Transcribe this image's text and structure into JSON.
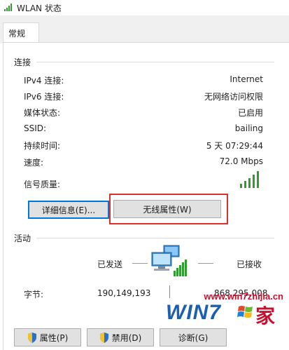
{
  "window": {
    "title": "WLAN 状态"
  },
  "tabs": [
    {
      "label": "常规"
    }
  ],
  "connection": {
    "section_label": "连接",
    "rows": [
      {
        "label": "IPv4 连接:",
        "value": "Internet"
      },
      {
        "label": "IPv6 连接:",
        "value": "无网络访问权限"
      },
      {
        "label": "媒体状态:",
        "value": "已启用"
      },
      {
        "label": "SSID:",
        "value": "bailing"
      },
      {
        "label": "持续时间:",
        "value": "5 天 07:29:44"
      },
      {
        "label": "速度:",
        "value": "72.0 Mbps"
      }
    ],
    "signal_label": "信号质量:",
    "signal_bars": 5,
    "details_button": "详细信息(E)...",
    "wireless_props_button": "无线属性(W)"
  },
  "activity": {
    "section_label": "活动",
    "sent_label": "已发送",
    "received_label": "已接收",
    "bytes_label": "字节:",
    "bytes_sent": "190,149,193",
    "bytes_received": "868,295,008"
  },
  "buttons": {
    "properties": "属性(P)",
    "disable": "禁用(D)",
    "diagnose": "诊断(G)"
  },
  "watermark": {
    "text": "www.win7zhijia.cn",
    "logo": "WIN7",
    "suffix": "家"
  },
  "colors": {
    "accent": "#0078d7",
    "signal": "#2f9e2f",
    "highlight_box": "#d9322e",
    "watermark": "#c8102e"
  }
}
